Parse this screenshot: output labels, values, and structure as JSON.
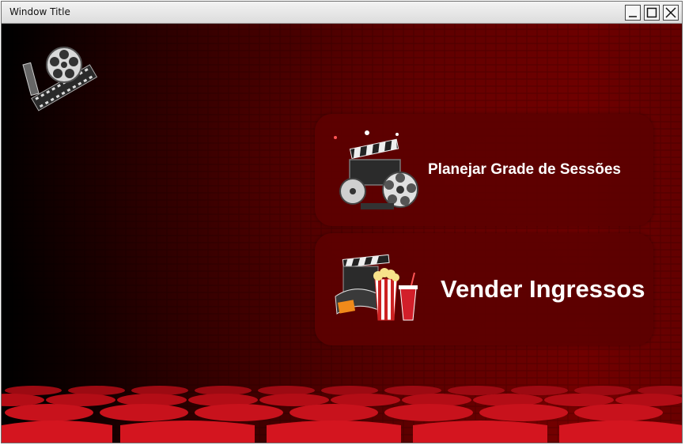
{
  "window": {
    "title": "Window Title"
  },
  "menu": {
    "plan_label": "Planejar Grade de Sessões",
    "sell_label": "Vender Ingressos"
  },
  "icons": {
    "logo": "film-reel-icon",
    "plan": "film-camera-icon",
    "sell": "popcorn-ticket-icon"
  },
  "colors": {
    "background_red": "#780000",
    "card": "#5c0000",
    "seat_red": "#c0101a",
    "text": "#ffffff"
  }
}
